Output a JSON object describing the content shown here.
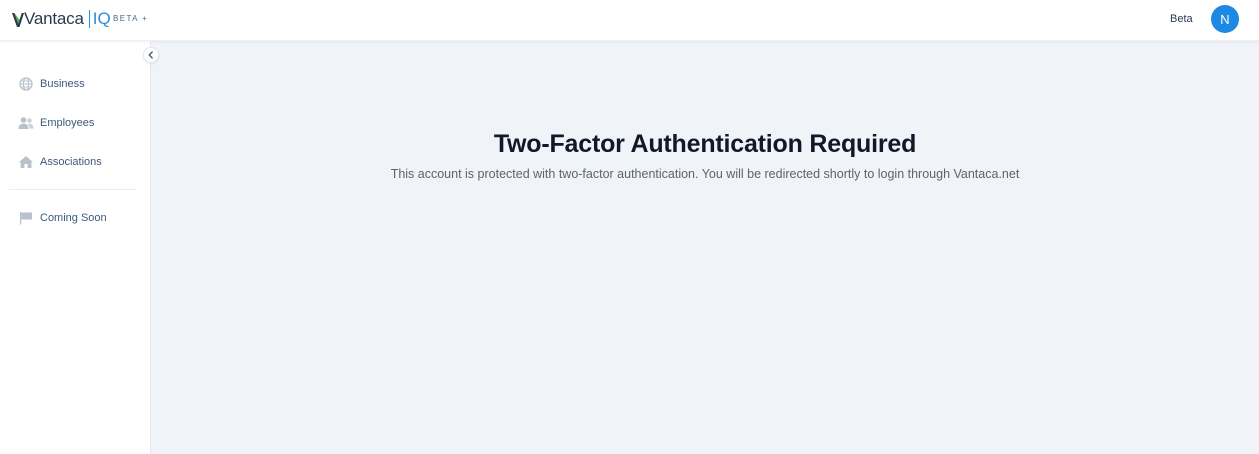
{
  "header": {
    "logo_text": "Vantaca",
    "logo_suffix": "IQ",
    "beta_tag": "BETA +",
    "beta_label": "Beta",
    "avatar_initial": "N"
  },
  "sidebar": {
    "items": [
      {
        "label": "Business",
        "icon": "globe-icon"
      },
      {
        "label": "Employees",
        "icon": "users-icon"
      },
      {
        "label": "Associations",
        "icon": "home-icon"
      }
    ],
    "secondary": [
      {
        "label": "Coming Soon",
        "icon": "flag-icon"
      }
    ]
  },
  "main": {
    "title": "Two-Factor Authentication Required",
    "message": "This account is protected with two-factor authentication. You will be redirected shortly to login through Vantaca.net"
  },
  "colors": {
    "accent": "#1e88e5",
    "logo_green": "#3fb44a",
    "nav_text": "#3e5a78",
    "icon_gray": "#b7c2cd",
    "main_bg": "#f0f3f7"
  }
}
